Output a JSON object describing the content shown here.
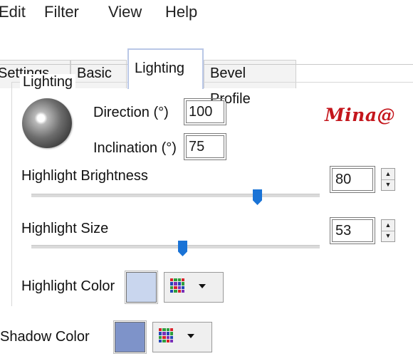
{
  "menu": [
    "Edit",
    "Filter",
    "View",
    "Help"
  ],
  "tabs": [
    {
      "label": "Settings",
      "active": false
    },
    {
      "label": "Basic",
      "active": false
    },
    {
      "label": "Lighting",
      "active": true
    },
    {
      "label": "Bevel Profile",
      "active": false
    }
  ],
  "lighting": {
    "group_title": "Lighting",
    "direction_label": "Direction (°)",
    "direction_value": "100",
    "inclination_label": "Inclination (°)",
    "inclination_value": "75",
    "highlight_brightness": {
      "label": "Highlight Brightness",
      "value": "80",
      "slider_fraction": 0.8
    },
    "highlight_size": {
      "label": "Highlight Size",
      "value": "53",
      "slider_fraction": 0.53
    },
    "highlight_color": {
      "label": "Highlight Color",
      "color": "#c9d6ee"
    }
  },
  "shadow_color": {
    "label": "Shadow Color",
    "color": "#7e93c9"
  },
  "watermark": "Mina@",
  "colors": {
    "accent": "#1a73d6",
    "watermark": "#c4161c"
  },
  "icons": [
    "sphere-preview-icon",
    "color-grid-icon",
    "chevron-down-icon",
    "spin-up-icon",
    "spin-down-icon"
  ]
}
